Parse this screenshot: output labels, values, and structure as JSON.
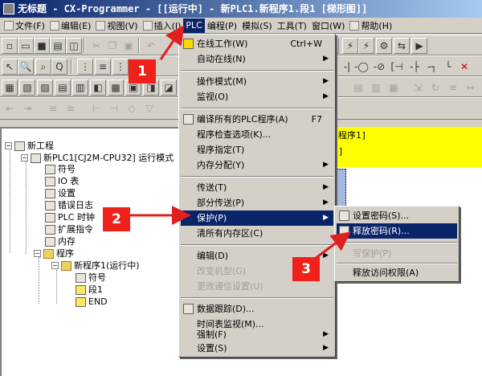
{
  "window": {
    "title": "无标题 - CX-Programmer - [[运行中] - 新PLC1.新程序1.段1 [梯形图]]"
  },
  "menubar": {
    "items": [
      {
        "label": "文件(F)",
        "icon": "file-icon"
      },
      {
        "label": "编辑(E)",
        "icon": "edit-icon"
      },
      {
        "label": "视图(V)",
        "icon": "view-icon"
      },
      {
        "label": "插入(I)",
        "icon": "insert-icon"
      },
      {
        "label": "PLC",
        "icon": ""
      },
      {
        "label": "编程(P)",
        "icon": ""
      },
      {
        "label": "模拟(S)",
        "icon": ""
      },
      {
        "label": "工具(T)",
        "icon": ""
      },
      {
        "label": "窗口(W)",
        "icon": ""
      },
      {
        "label": "帮助(H)",
        "icon": "help-icon"
      }
    ]
  },
  "plc_menu": {
    "items": [
      {
        "label": "在线工作(W)",
        "shortcut": "Ctrl+W",
        "icon": "online-warning-icon"
      },
      {
        "label": "自动在线(N)",
        "submenu": true
      },
      {
        "label": "操作模式(M)",
        "submenu": true
      },
      {
        "label": "监视(O)",
        "submenu": true
      },
      {
        "label": "编译所有的PLC程序(A)",
        "shortcut": "F7",
        "icon": "compile-icon"
      },
      {
        "label": "程序检查选项(K)..."
      },
      {
        "label": "程序指定(T)"
      },
      {
        "label": "内存分配(Y)",
        "submenu": true
      },
      {
        "label": "传送(T)",
        "submenu": true
      },
      {
        "label": "部分传送(P)",
        "submenu": true
      },
      {
        "label": "保护(P)",
        "submenu": true
      },
      {
        "label": "清所有内存区(C)"
      },
      {
        "label": "编辑(D)",
        "submenu": true
      },
      {
        "label": "改变机型(G)"
      },
      {
        "label": "更改通信设置(U)"
      },
      {
        "label": "数据跟踪(D)...",
        "icon": "data-trace-icon"
      },
      {
        "label": "时间表监视(M)..."
      },
      {
        "label": "强制(F)",
        "submenu": true
      },
      {
        "label": "设置(S)",
        "submenu": true
      }
    ]
  },
  "protect_menu": {
    "items": [
      {
        "label": "设置密码(S)...",
        "icon": "set-password-icon"
      },
      {
        "label": "释放密码(R)...",
        "icon": "release-password-icon"
      },
      {
        "label": "写保护(P)"
      },
      {
        "label": "释放访问权限(A)"
      }
    ]
  },
  "tree": {
    "items": [
      {
        "label": "新工程"
      },
      {
        "label": "新PLC1[CJ2M-CPU32] 运行模式"
      },
      {
        "label": "符号"
      },
      {
        "label": "IO 表"
      },
      {
        "label": "设置"
      },
      {
        "label": "错误日志"
      },
      {
        "label": "PLC 时钟"
      },
      {
        "label": "扩展指令"
      },
      {
        "label": "内存"
      },
      {
        "label": "程序"
      },
      {
        "label": "新程序1(运行中)"
      },
      {
        "label": "符号"
      },
      {
        "label": "段1"
      },
      {
        "label": "END"
      }
    ]
  },
  "diagram": {
    "line1": "程序1]",
    "line2": "]"
  },
  "annotations": {
    "step1": "1",
    "step2": "2",
    "step3": "3",
    "color": "#f0201a"
  }
}
